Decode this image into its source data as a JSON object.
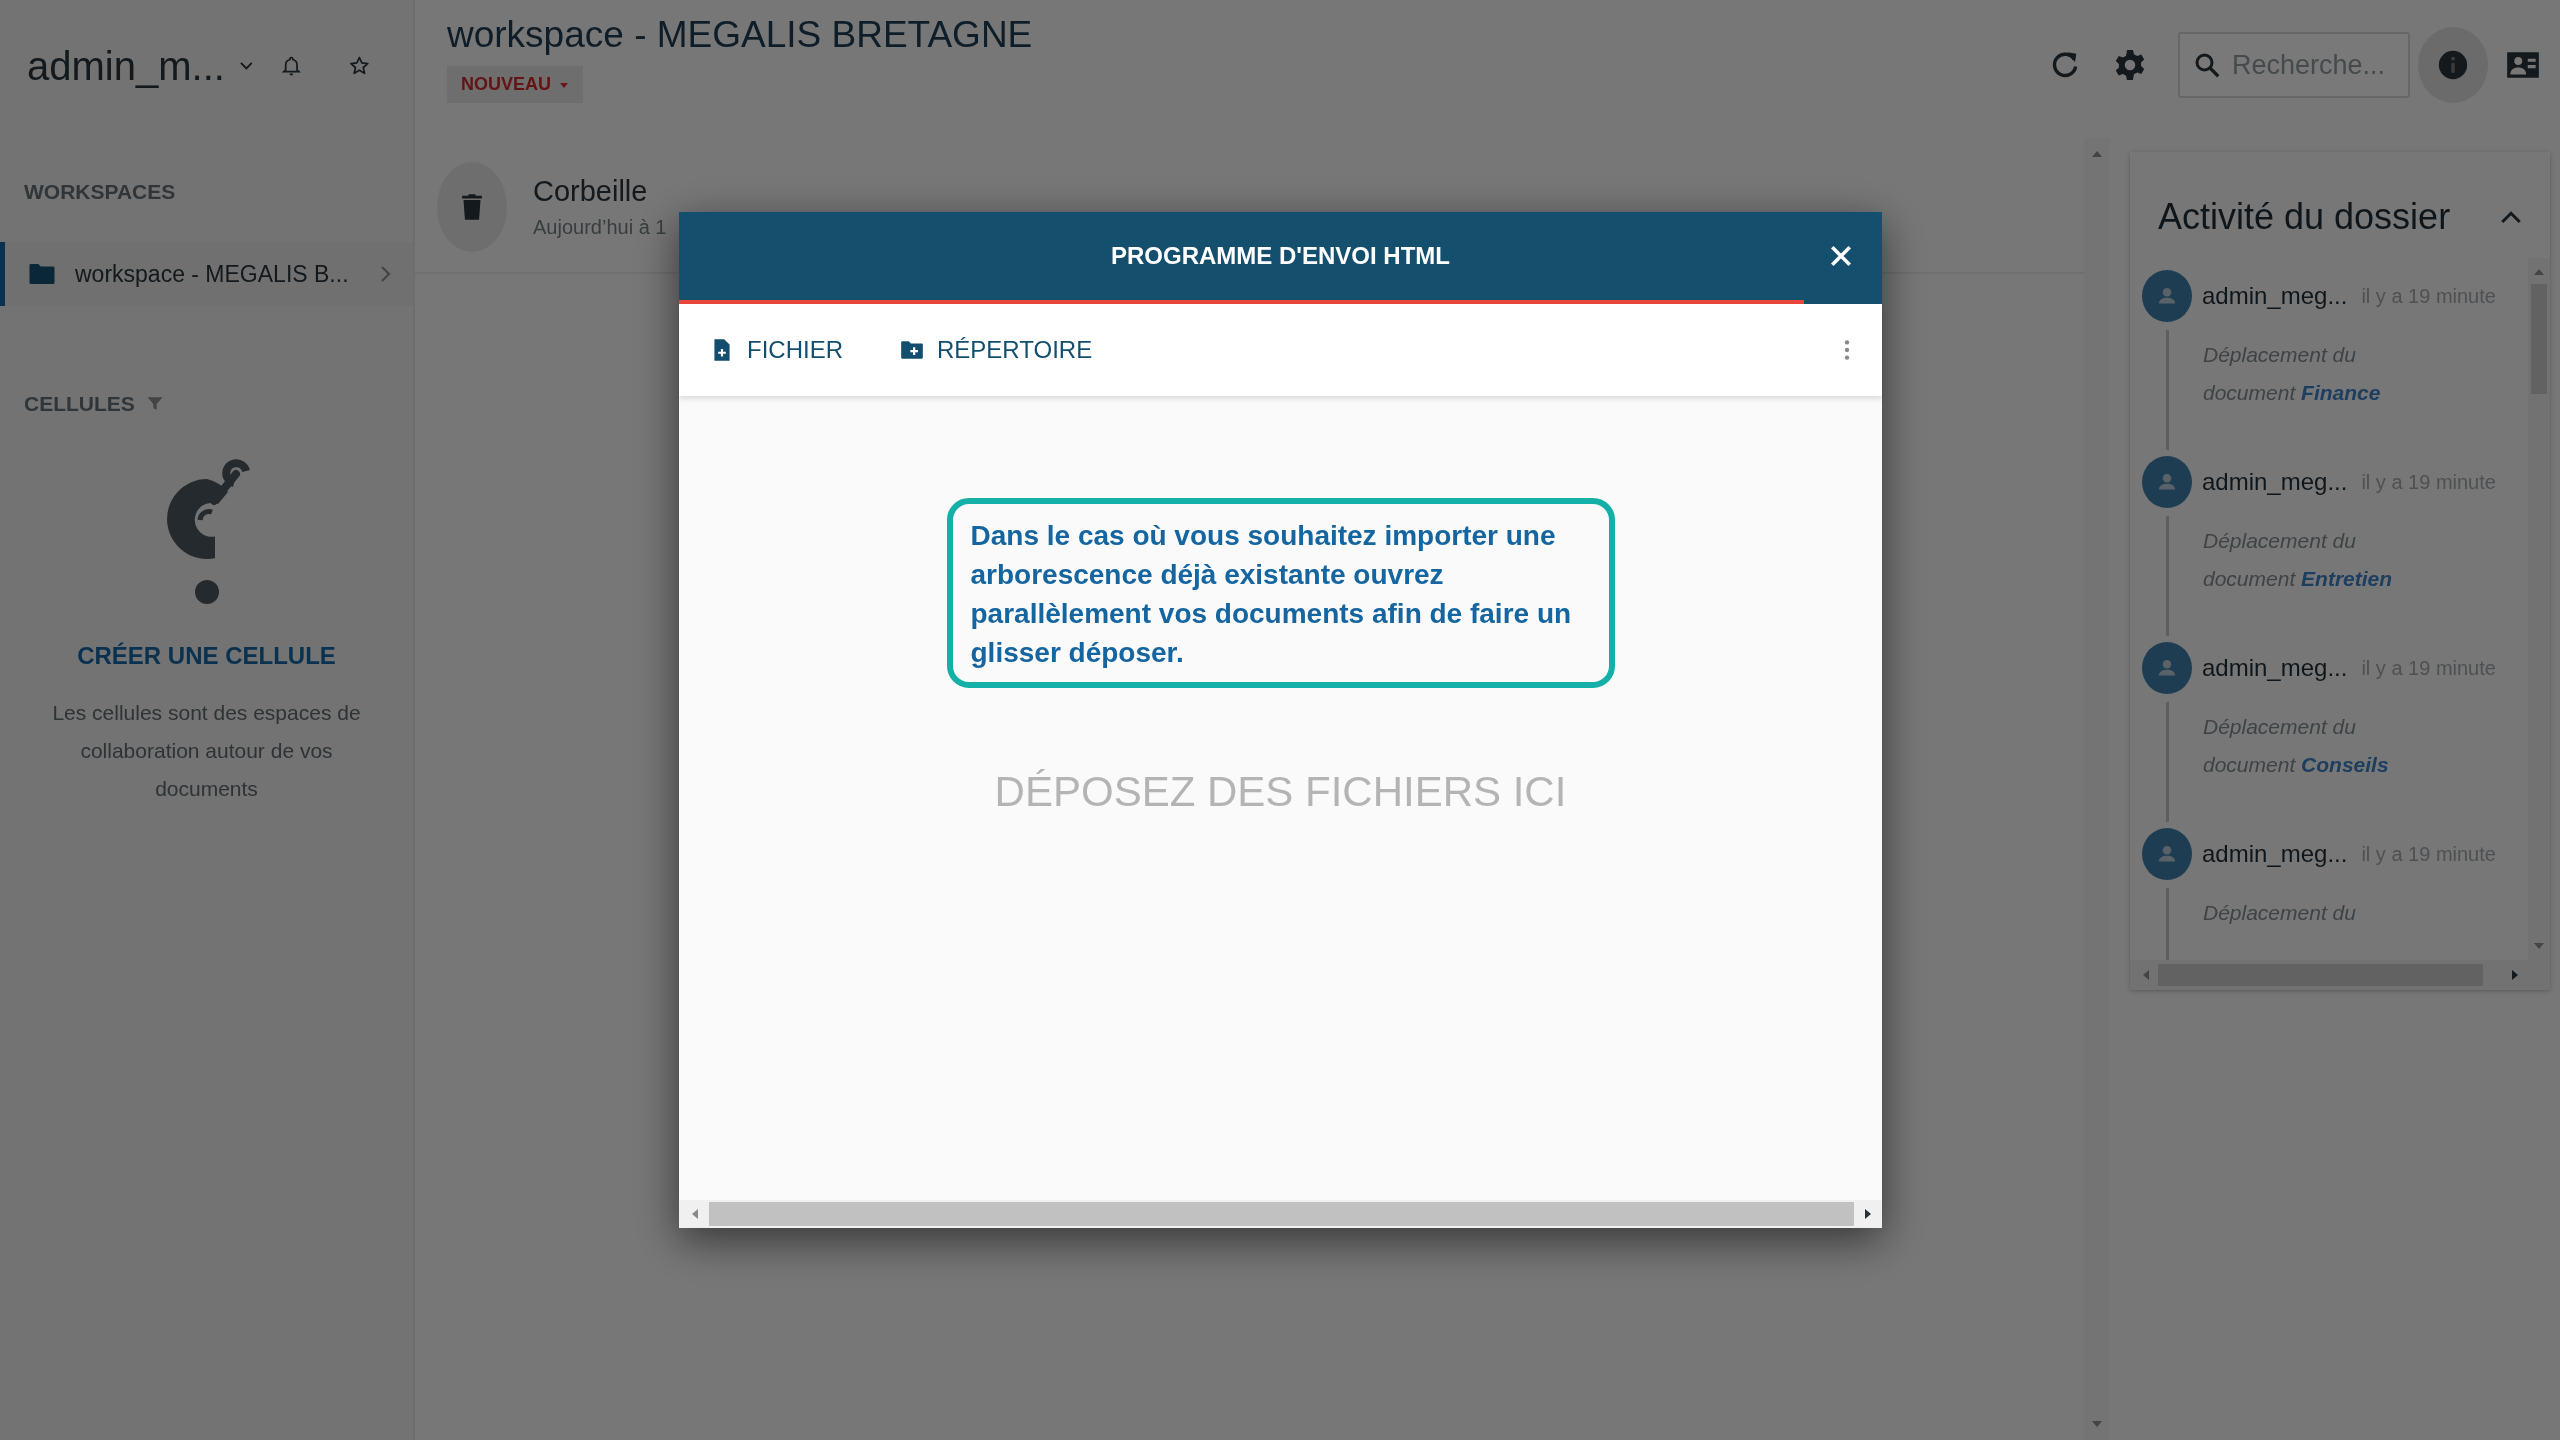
{
  "sidebar": {
    "user_menu": {
      "label": "admin_m..."
    },
    "workspaces_heading": "WORKSPACES",
    "workspaces": [
      {
        "label": "workspace - MEGALIS B...",
        "selected": true
      }
    ],
    "cells_heading": "CELLULES",
    "cells_empty": {
      "action": "CRÉER UNE CELLULE",
      "description": "Les cellules sont des espaces de collaboration autour de vos documents"
    }
  },
  "header": {
    "title": "workspace - MEGALIS BRETAGNE",
    "new_button": "NOUVEAU",
    "search": {
      "placeholder": "Recherche..."
    },
    "info_active": true
  },
  "files": [
    {
      "name": "Corbeille",
      "modified": "Aujourd’hui à 1"
    }
  ],
  "activity": {
    "title": "Activité du dossier",
    "expanded": true,
    "entries": [
      {
        "user": "admin_meg...",
        "time": "il y a 19 minute",
        "text": "Déplacement du document",
        "target": "Finance"
      },
      {
        "user": "admin_meg...",
        "time": "il y a 19 minute",
        "text": "Déplacement du document",
        "target": "Entretien"
      },
      {
        "user": "admin_meg...",
        "time": "il y a 19 minute",
        "text": "Déplacement du document",
        "target": "Conseils"
      },
      {
        "user": "admin_meg...",
        "time": "il y a 19 minute",
        "text": "Déplacement du"
      }
    ]
  },
  "upload_dialog": {
    "title": "PROGRAMME D'ENVOI HTML",
    "level": 0.935,
    "actions": [
      {
        "kind": "file",
        "label": "FICHIER"
      },
      {
        "kind": "folder",
        "label": "RÉPERTOIRE"
      }
    ],
    "callout": "Dans le cas où vous souhaitez importer une arborescence déjà existante ouvrez parallèlement vos documents afin de faire un glisser déposer.",
    "drop_hint": "DÉPOSEZ DES FICHIERS ICI"
  }
}
